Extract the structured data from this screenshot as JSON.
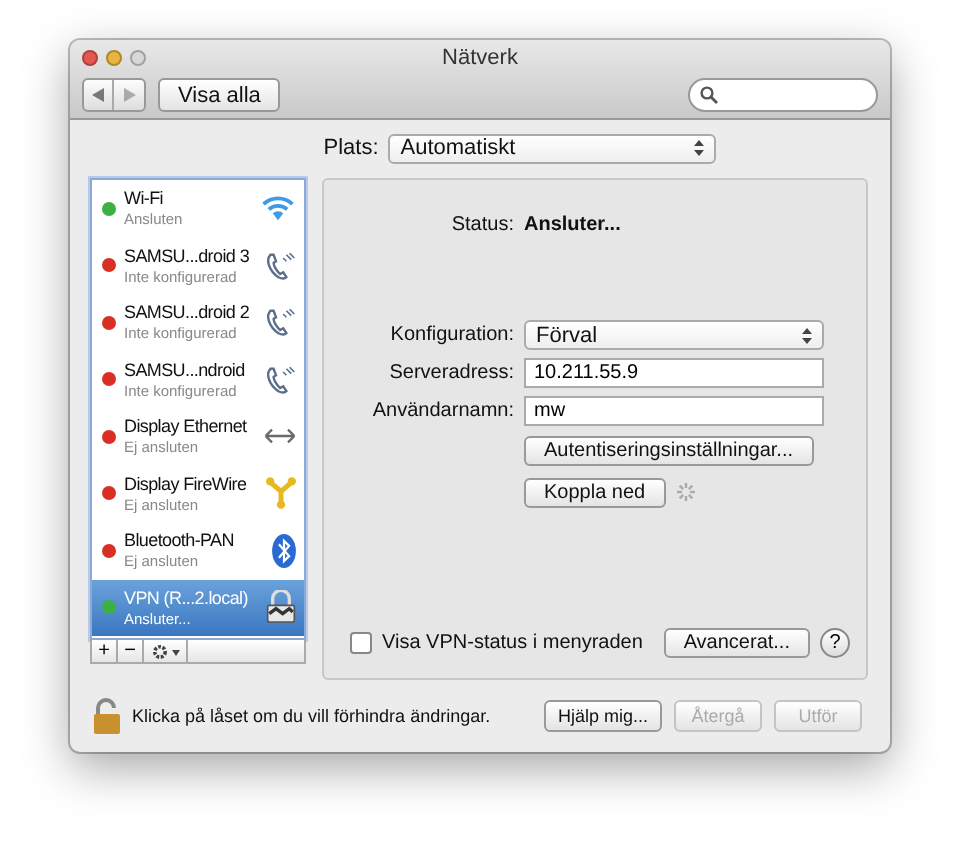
{
  "window": {
    "title": "Nätverk"
  },
  "toolbar": {
    "show_all": "Visa alla"
  },
  "location": {
    "label": "Plats:",
    "value": "Automatiskt"
  },
  "services": [
    {
      "name": "Wi-Fi",
      "status": "Ansluten",
      "color": "#3cb043",
      "kind": "wifi",
      "selected": false
    },
    {
      "name": "SAMSU...droid 3",
      "status": "Inte konfigurerad",
      "color": "#d93025",
      "kind": "phone",
      "selected": false
    },
    {
      "name": "SAMSU...droid 2",
      "status": "Inte konfigurerad",
      "color": "#d93025",
      "kind": "phone",
      "selected": false
    },
    {
      "name": "SAMSU...ndroid",
      "status": "Inte konfigurerad",
      "color": "#d93025",
      "kind": "phone",
      "selected": false
    },
    {
      "name": "Display Ethernet",
      "status": "Ej ansluten",
      "color": "#d93025",
      "kind": "ethernet",
      "selected": false
    },
    {
      "name": "Display FireWire",
      "status": "Ej ansluten",
      "color": "#d93025",
      "kind": "firewire",
      "selected": false
    },
    {
      "name": "Bluetooth-PAN",
      "status": "Ej ansluten",
      "color": "#d93025",
      "kind": "bluetooth",
      "selected": false
    },
    {
      "name": "VPN (R...2.local)",
      "status": "Ansluter...",
      "color": "#3cb043",
      "kind": "vpn",
      "selected": true
    }
  ],
  "list_buttons": [
    "+",
    "−"
  ],
  "detail": {
    "status_label": "Status:",
    "status_value": "Ansluter...",
    "fields": [
      {
        "kind": "select",
        "label": "Konfiguration:",
        "value": "Förval"
      },
      {
        "kind": "text",
        "label": "Serveradress:",
        "value": "10.211.55.9"
      },
      {
        "kind": "text",
        "label": "Användarnamn:",
        "value": "mw"
      }
    ],
    "auth_button": "Autentiseringsinställningar...",
    "disconnect_button": "Koppla ned",
    "show_status": {
      "label": "Visa VPN-status i menyraden",
      "checked": false
    },
    "advanced_button": "Avancerat...",
    "help": "?"
  },
  "footer": {
    "lock_text": "Klicka på låset om du vill förhindra ändringar.",
    "buttons": [
      {
        "label": "Hjälp mig...",
        "disabled": false
      },
      {
        "label": "Återgå",
        "disabled": true
      },
      {
        "label": "Utför",
        "disabled": true
      }
    ]
  }
}
